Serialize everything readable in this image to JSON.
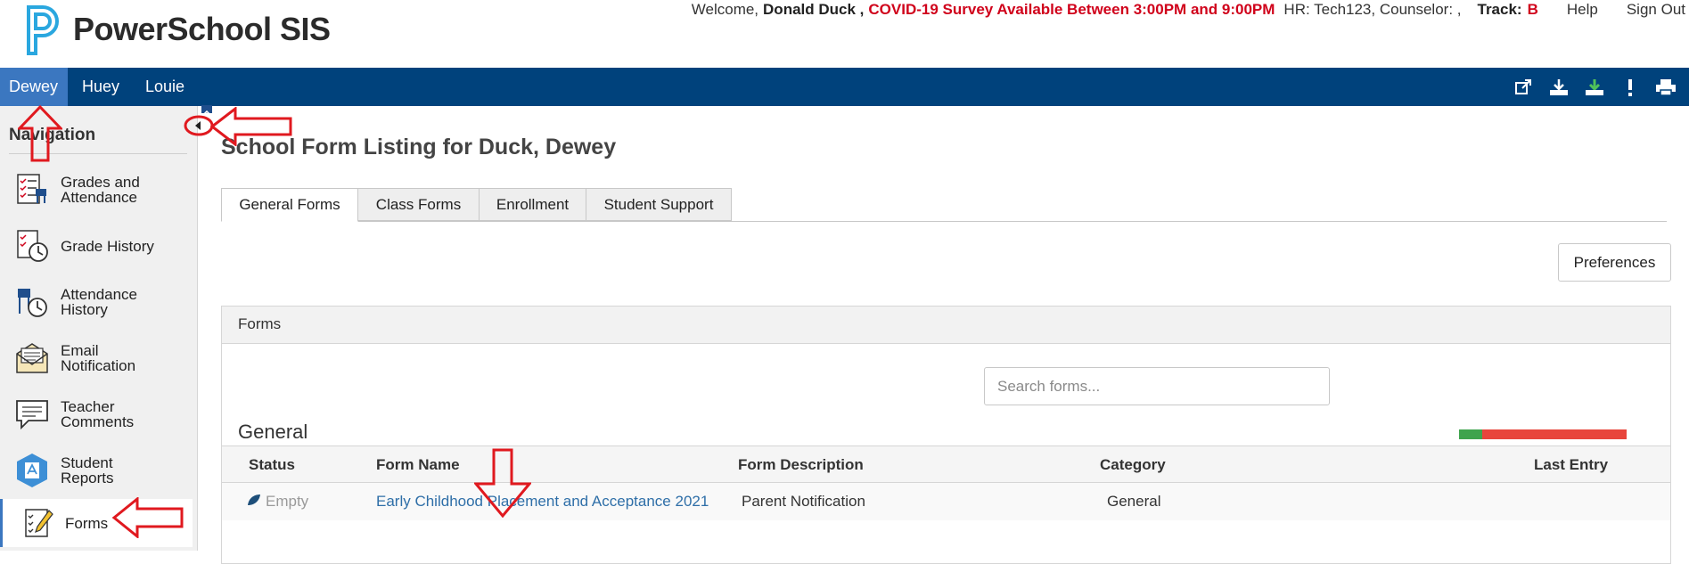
{
  "header": {
    "app_name": "PowerSchool SIS",
    "welcome": "Welcome,",
    "user_name": "Donald Duck ,",
    "alert": "COVID-19 Survey Available Between 3:00PM and 9:00PM",
    "hr": "HR: Tech123, Counselor:  ,",
    "track_label": "Track:",
    "track_value": "B",
    "help": "Help",
    "sign_out": "Sign Out"
  },
  "students": [
    "Dewey",
    "Huey",
    "Louie"
  ],
  "toolbar_icons": [
    "external-link-icon",
    "download-icon",
    "download-green-icon",
    "alert-icon",
    "print-icon"
  ],
  "sidebar": {
    "heading": "Navigation",
    "items": [
      {
        "label": "Grades and Attendance",
        "icon": "grades-attendance-icon"
      },
      {
        "label": "Grade History",
        "icon": "grade-history-icon"
      },
      {
        "label": "Attendance History",
        "icon": "attendance-history-icon"
      },
      {
        "label": "Email Notification",
        "icon": "email-notification-icon"
      },
      {
        "label": "Teacher Comments",
        "icon": "teacher-comments-icon"
      },
      {
        "label": "Student Reports",
        "icon": "student-reports-icon"
      },
      {
        "label": "Forms",
        "icon": "forms-icon"
      }
    ]
  },
  "main": {
    "title": "School Form Listing for Duck, Dewey",
    "tabs": [
      "General Forms",
      "Class Forms",
      "Enrollment",
      "Student Support"
    ],
    "preferences": "Preferences",
    "forms_header": "Forms",
    "search_placeholder": "Search forms...",
    "section": "General",
    "progress_fraction": 0.14,
    "columns": [
      "Status",
      "Form Name",
      "Form Description",
      "Category",
      "Last Entry"
    ],
    "rows": [
      {
        "status": "Empty",
        "form_name": "Early Childhood Placement and Acceptance 2021",
        "description": "Parent Notification",
        "category": "General",
        "last_entry": ""
      }
    ]
  },
  "colors": {
    "nav_blue": "#00427c",
    "active_tab_blue": "#3b77c0",
    "alert_red": "#d0021b",
    "link_blue": "#2f6fa8",
    "progress_green": "#3fa34d",
    "progress_red": "#e8453c",
    "annotation_red": "#e0191f"
  }
}
